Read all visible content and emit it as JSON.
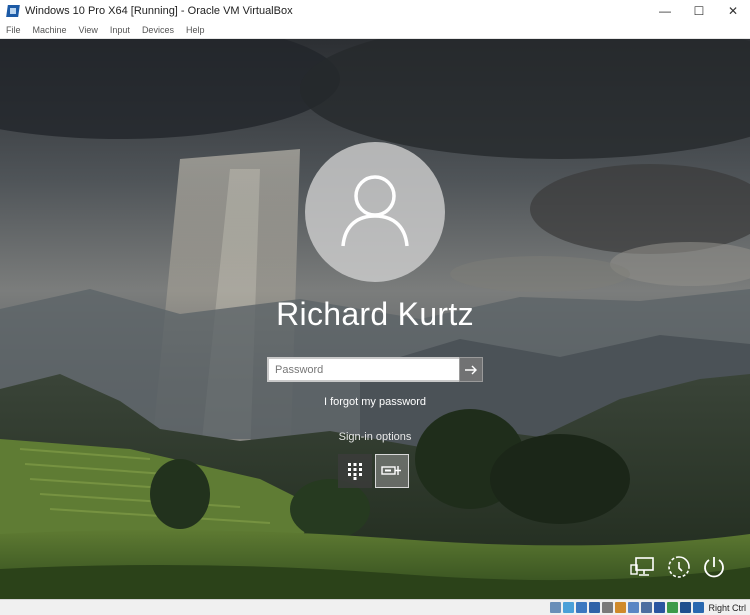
{
  "window": {
    "title": "Windows 10 Pro X64 [Running] - Oracle VM VirtualBox",
    "minimize": "—",
    "maximize": "☐",
    "close": "✕"
  },
  "menu": [
    "File",
    "Machine",
    "View",
    "Input",
    "Devices",
    "Help"
  ],
  "login": {
    "user_name": "Richard Kurtz",
    "password_placeholder": "Password",
    "password_value": "",
    "forgot_link": "I forgot my password",
    "signin_options": "Sign-in options"
  },
  "status": {
    "host_key": "Right Ctrl"
  },
  "colors": {
    "accent_white": "#ffffff",
    "avatar_bg": "#cdcdcd"
  },
  "icons": {
    "avatar": "user-silhouette-icon",
    "submit": "arrow-right-icon",
    "pin": "keypad-icon",
    "key": "security-key-icon",
    "network": "network-icon",
    "ease": "ease-of-access-icon",
    "power": "power-icon"
  }
}
